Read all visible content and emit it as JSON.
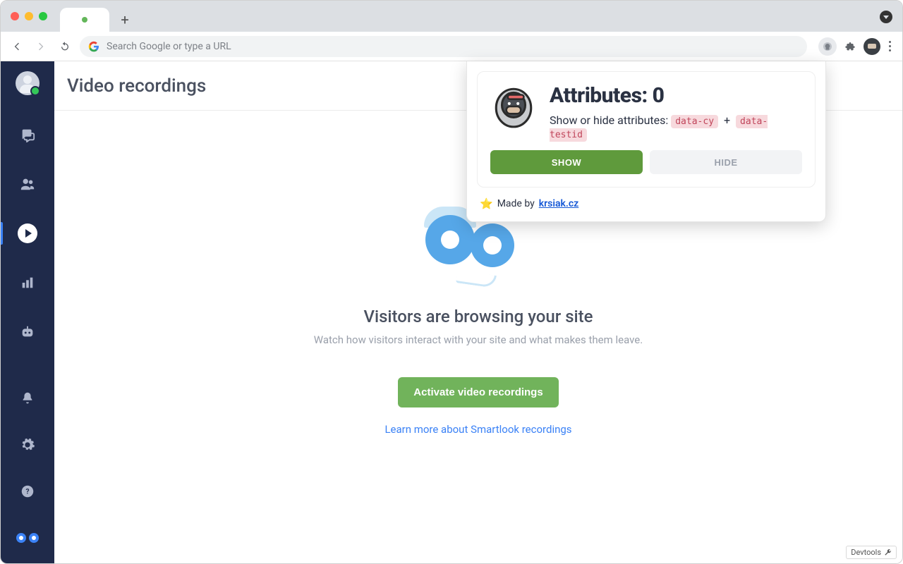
{
  "browser": {
    "omnibox_placeholder": "Search Google or type a URL"
  },
  "page": {
    "title": "Video recordings",
    "headline": "Visitors are browsing your site",
    "subline": "Watch how visitors interact with your site and what makes them leave.",
    "cta_label": "Activate video recordings",
    "learn_more": "Learn more about Smartlook recordings"
  },
  "extension": {
    "title_prefix": "Attributes: ",
    "count": "0",
    "desc_prefix": "Show or hide attributes: ",
    "tag1": "data-cy",
    "plus": "+",
    "tag2": "data-testid",
    "show_label": "SHOW",
    "hide_label": "HIDE",
    "made_by_prefix": "Made by ",
    "made_by_link": "krsiak.cz"
  },
  "devtools": {
    "label": "Devtools"
  }
}
